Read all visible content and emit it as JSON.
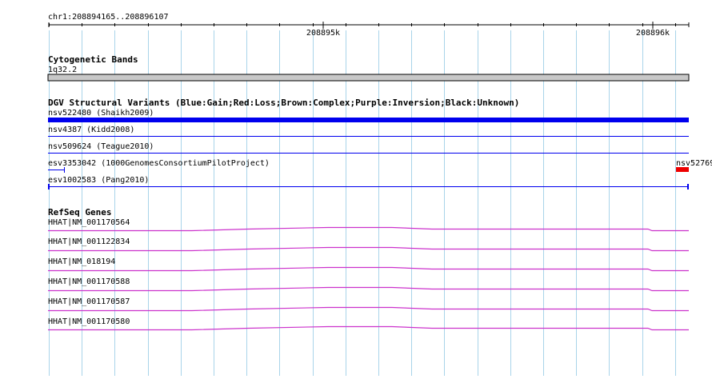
{
  "ruler": {
    "range_label": "chr1:208894165..208896107",
    "ticks": [
      {
        "label": "208895k"
      },
      {
        "label": "208896k"
      }
    ]
  },
  "cytoband": {
    "title": "Cytogenetic Bands",
    "band_label": "1q32.2"
  },
  "dgv": {
    "title": "DGV Structural Variants (Blue:Gain;Red:Loss;Brown:Complex;Purple:Inversion;Black:Unknown)",
    "features": [
      {
        "label": "nsv522480 (Shaikh2009)",
        "type": "Gain"
      },
      {
        "label": "nsv4387 (Kidd2008)",
        "type": "Gain"
      },
      {
        "label": "nsv509624 (Teague2010)",
        "type": "Gain"
      },
      {
        "label": "esv3353042 (1000GenomesConsortiumPilotProject)",
        "type": "Gain"
      },
      {
        "label": "nsv52769",
        "type": "Loss"
      },
      {
        "label": "esv1002583 (Pang2010)",
        "type": "Gain"
      }
    ]
  },
  "refseq": {
    "title": "RefSeq Genes",
    "genes": [
      {
        "label": "HHAT|NM_001170564"
      },
      {
        "label": "HHAT|NM_001122834"
      },
      {
        "label": "HHAT|NM_018194"
      },
      {
        "label": "HHAT|NM_001170588"
      },
      {
        "label": "HHAT|NM_001170587"
      },
      {
        "label": "HHAT|NM_001170580"
      }
    ]
  },
  "colors": {
    "gain": "#0000ee",
    "loss": "#ee0000",
    "gene": "#cc33cc",
    "grid": "#a9d4ea",
    "band": "#c8c8c8"
  }
}
